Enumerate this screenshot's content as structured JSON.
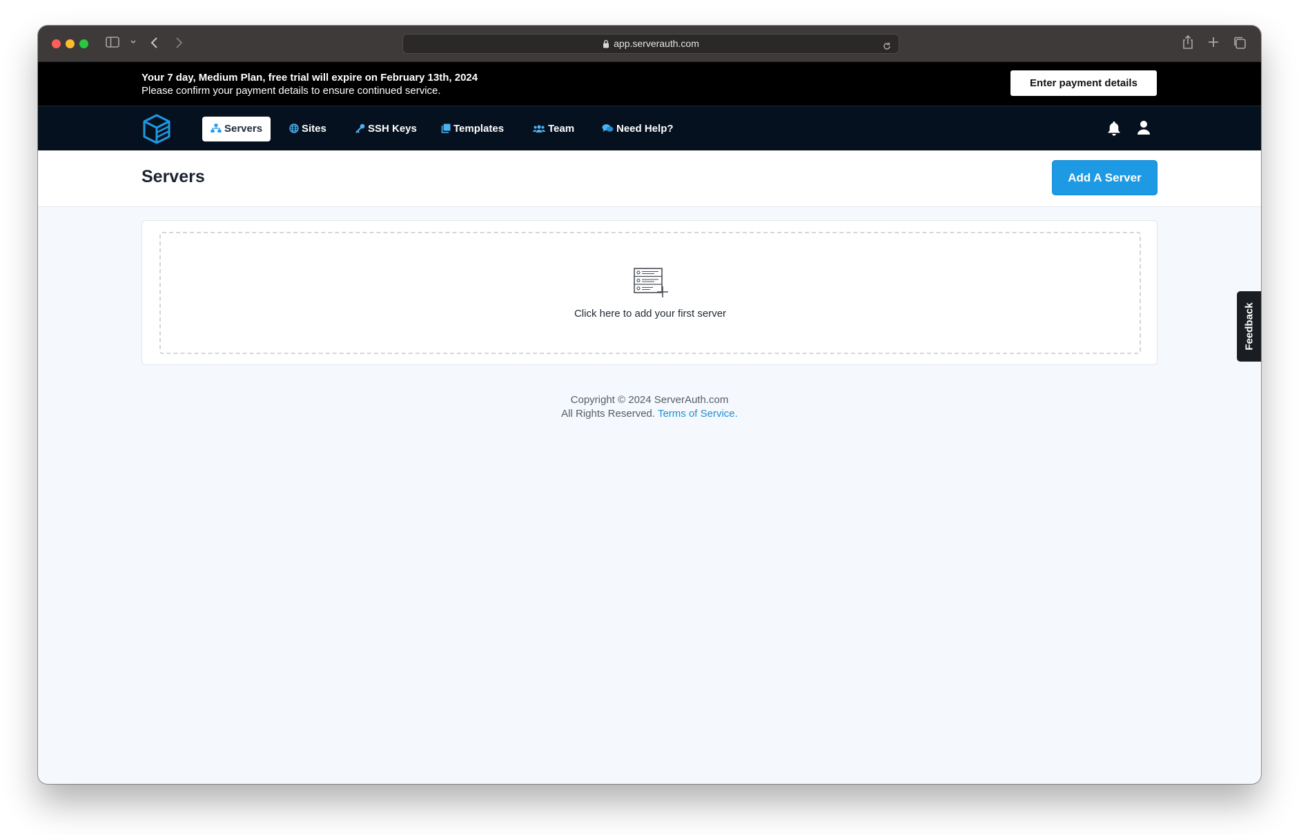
{
  "browser": {
    "url": "app.serverauth.com"
  },
  "trial_banner": {
    "line1": "Your 7 day, Medium Plan, free trial will expire on February 13th, 2024",
    "line2": "Please confirm your payment details to ensure continued service.",
    "button_label": "Enter payment details"
  },
  "nav": {
    "items": [
      {
        "label": "Servers",
        "icon": "servers-icon",
        "active": true
      },
      {
        "label": "Sites",
        "icon": "globe-icon"
      },
      {
        "label": "SSH Keys",
        "icon": "key-icon"
      },
      {
        "label": "Templates",
        "icon": "templates-icon"
      },
      {
        "label": "Team",
        "icon": "team-icon"
      },
      {
        "label": "Need Help?",
        "icon": "chat-icon"
      }
    ],
    "right_icons": [
      "bell-icon",
      "user-icon"
    ]
  },
  "page": {
    "title": "Servers",
    "add_button_label": "Add A Server",
    "empty_state_text": "Click here to add your first server",
    "empty_state_icon": "server-list-add-icon"
  },
  "footer": {
    "copyright": "Copyright © 2024 ServerAuth.com",
    "rights": "All Rights Reserved.",
    "terms_link": "Terms of Service",
    "terms_suffix": "."
  },
  "feedback_label": "Feedback",
  "colors": {
    "accent": "#1d9ae3",
    "nav_bg": "#06111f",
    "banner_bg": "#000000",
    "page_bg": "#f5f8fc"
  }
}
